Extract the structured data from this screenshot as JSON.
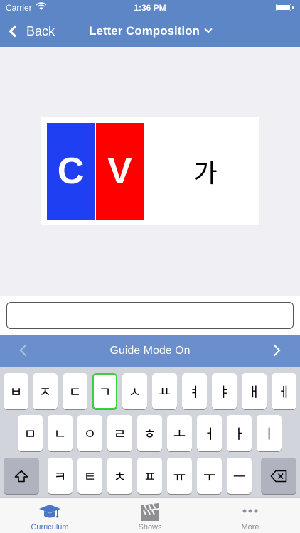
{
  "status_bar": {
    "carrier": "Carrier",
    "time": "1:36 PM"
  },
  "nav": {
    "back_label": "Back",
    "title": "Letter Composition"
  },
  "card": {
    "consonant_letter": "C",
    "vowel_letter": "V",
    "result_hangul": "가",
    "consonant_color": "#1f3ff2",
    "vowel_color": "#ff0000"
  },
  "answer_input": {
    "value": ""
  },
  "guide": {
    "label": "Guide Mode On"
  },
  "keyboard": {
    "row1": [
      "ㅂ",
      "ㅈ",
      "ㄷ",
      "ㄱ",
      "ㅅ",
      "ㅛ",
      "ㅕ",
      "ㅑ",
      "ㅐ",
      "ㅔ"
    ],
    "row2": [
      "ㅁ",
      "ㄴ",
      "ㅇ",
      "ㄹ",
      "ㅎ",
      "ㅗ",
      "ㅓ",
      "ㅏ",
      "ㅣ"
    ],
    "row3": [
      "ㅋ",
      "ㅌ",
      "ㅊ",
      "ㅍ",
      "ㅠ",
      "ㅜ",
      "ㅡ"
    ],
    "highlighted_key": "ㄱ",
    "shift_icon": "shift-icon",
    "delete_icon": "delete-icon"
  },
  "tabs": [
    {
      "label": "Curriculum",
      "icon": "graduation-cap-icon",
      "active": true
    },
    {
      "label": "Shows",
      "icon": "clapperboard-icon",
      "active": false
    },
    {
      "label": "More",
      "icon": "more-icon",
      "active": false
    }
  ]
}
